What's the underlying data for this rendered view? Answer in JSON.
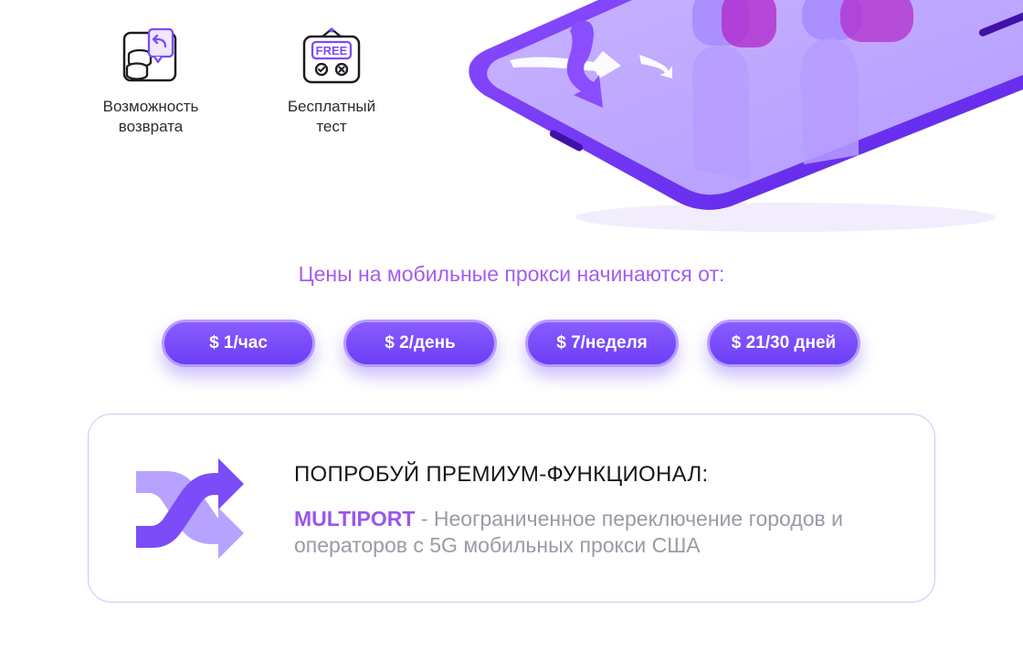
{
  "features": [
    {
      "icon": "refund-icon",
      "label": "Возможность\nвозврата"
    },
    {
      "icon": "free-test-icon",
      "label": "Бесплатный\nтест",
      "badge": "FREE"
    }
  ],
  "prices": {
    "heading": "Цены на мобильные прокси начинаются от:",
    "items": [
      "$ 1/час",
      "$ 2/день",
      "$ 7/неделя",
      "$ 21/30 дней"
    ]
  },
  "premium": {
    "title": "ПОПРОБУЙ ПРЕМИУМ-ФУНКЦИОНАЛ:",
    "highlight": "MULTIPORT",
    "description": " - Неограниченное переключение городов и операторов с 5G мобильных прокси США",
    "icon": "shuffle-icon"
  },
  "colors": {
    "accent": "#7b4cf7",
    "heading": "#a35df0",
    "highlight": "#9b55ef",
    "muted": "#9a9aa8"
  }
}
